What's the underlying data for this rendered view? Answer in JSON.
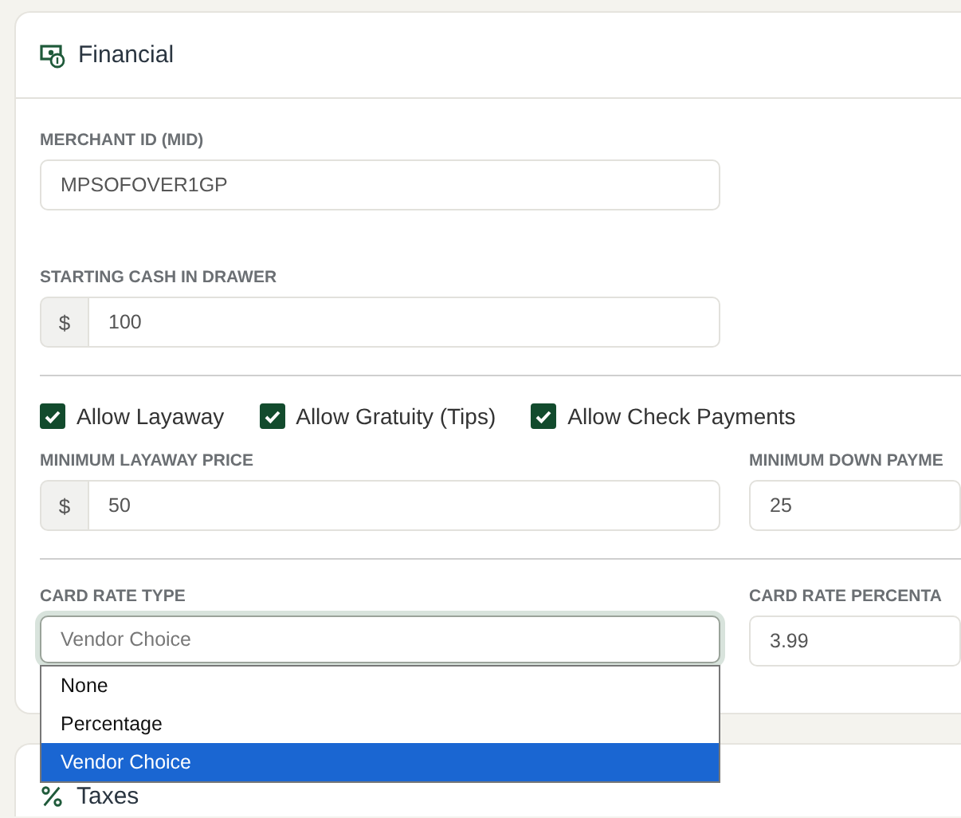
{
  "financial": {
    "title": "Financial",
    "merchant_id": {
      "label": "MERCHANT ID (MID)",
      "value": "MPSOFOVER1GP"
    },
    "starting_cash": {
      "label": "STARTING CASH IN DRAWER",
      "prefix": "$",
      "value": "100"
    },
    "options": [
      {
        "label": "Allow Layaway",
        "checked": true
      },
      {
        "label": "Allow Gratuity (Tips)",
        "checked": true
      },
      {
        "label": "Allow Check Payments",
        "checked": true
      }
    ],
    "min_layaway_price": {
      "label": "MINIMUM LAYAWAY PRICE",
      "prefix": "$",
      "value": "50"
    },
    "min_down_payment": {
      "label": "MINIMUM DOWN PAYME",
      "value": "25"
    },
    "card_rate_type": {
      "label": "CARD RATE TYPE",
      "value": "Vendor Choice",
      "expanded": true,
      "options": [
        {
          "label": "None",
          "selected": false
        },
        {
          "label": "Percentage",
          "selected": false
        },
        {
          "label": "Vendor Choice",
          "selected": true
        }
      ]
    },
    "card_rate_percentage": {
      "label": "CARD RATE PERCENTA",
      "value": "3.99"
    }
  },
  "taxes": {
    "title": "Taxes"
  }
}
